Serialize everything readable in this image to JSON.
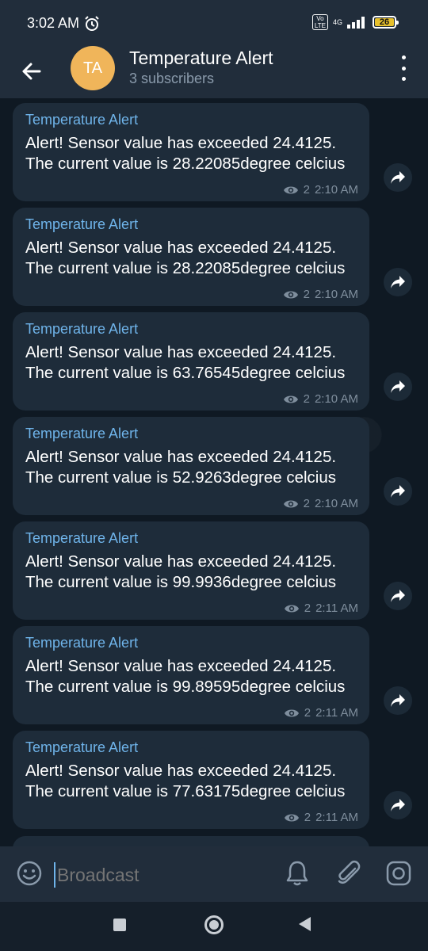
{
  "status_bar": {
    "time": "3:02 AM",
    "volte_label": "Vo\nLTE",
    "network": "4G",
    "battery": "26",
    "battery_level": 0.26,
    "icons": [
      "alarm-icon",
      "volte-icon",
      "signal-icon",
      "battery-icon"
    ]
  },
  "header": {
    "avatar_initials": "TA",
    "avatar_color": "#f0b55a",
    "title": "Temperature Alert",
    "subtitle": "3 subscribers",
    "icons": [
      "back-arrow-icon",
      "more-vert-icon"
    ]
  },
  "messages": [
    {
      "sender": "Temperature Alert",
      "text": "Alert! Sensor value has exceeded 24.4125. The current value is 28.22085degree celcius",
      "views": "2",
      "time": "2:10 AM"
    },
    {
      "sender": "Temperature Alert",
      "text": "Alert! Sensor value has exceeded 24.4125. The current value is 28.22085degree celcius",
      "views": "2",
      "time": "2:10 AM"
    },
    {
      "sender": "Temperature Alert",
      "text": "Alert! Sensor value has exceeded 24.4125. The current value is 63.76545degree celcius",
      "views": "2",
      "time": "2:10 AM"
    },
    {
      "sender": "Temperature Alert",
      "text": "Alert! Sensor value has exceeded 24.4125. The current value is 52.9263degree celcius",
      "views": "2",
      "time": "2:10 AM"
    },
    {
      "sender": "Temperature Alert",
      "text": "Alert! Sensor value has exceeded 24.4125. The current value is 99.9936degree celcius",
      "views": "2",
      "time": "2:11 AM"
    },
    {
      "sender": "Temperature Alert",
      "text": "Alert! Sensor value has exceeded 24.4125. The current value is 99.89595degree celcius",
      "views": "2",
      "time": "2:11 AM"
    },
    {
      "sender": "Temperature Alert",
      "text": "Alert! Sensor value has exceeded 24.4125. The current value is 77.63175degree celcius",
      "views": "2",
      "time": "2:11 AM"
    }
  ],
  "input": {
    "placeholder": "Broadcast",
    "icons": [
      "emoji-icon",
      "bell-icon",
      "attach-icon",
      "camera-icon"
    ]
  },
  "nav_bar": {
    "icons": [
      "recents-icon",
      "home-icon",
      "back-icon"
    ]
  },
  "colors": {
    "accent": "#6fb4ea",
    "bubble": "#1e2c3a",
    "header": "#212d3b",
    "chat_background": "#0f1923"
  }
}
